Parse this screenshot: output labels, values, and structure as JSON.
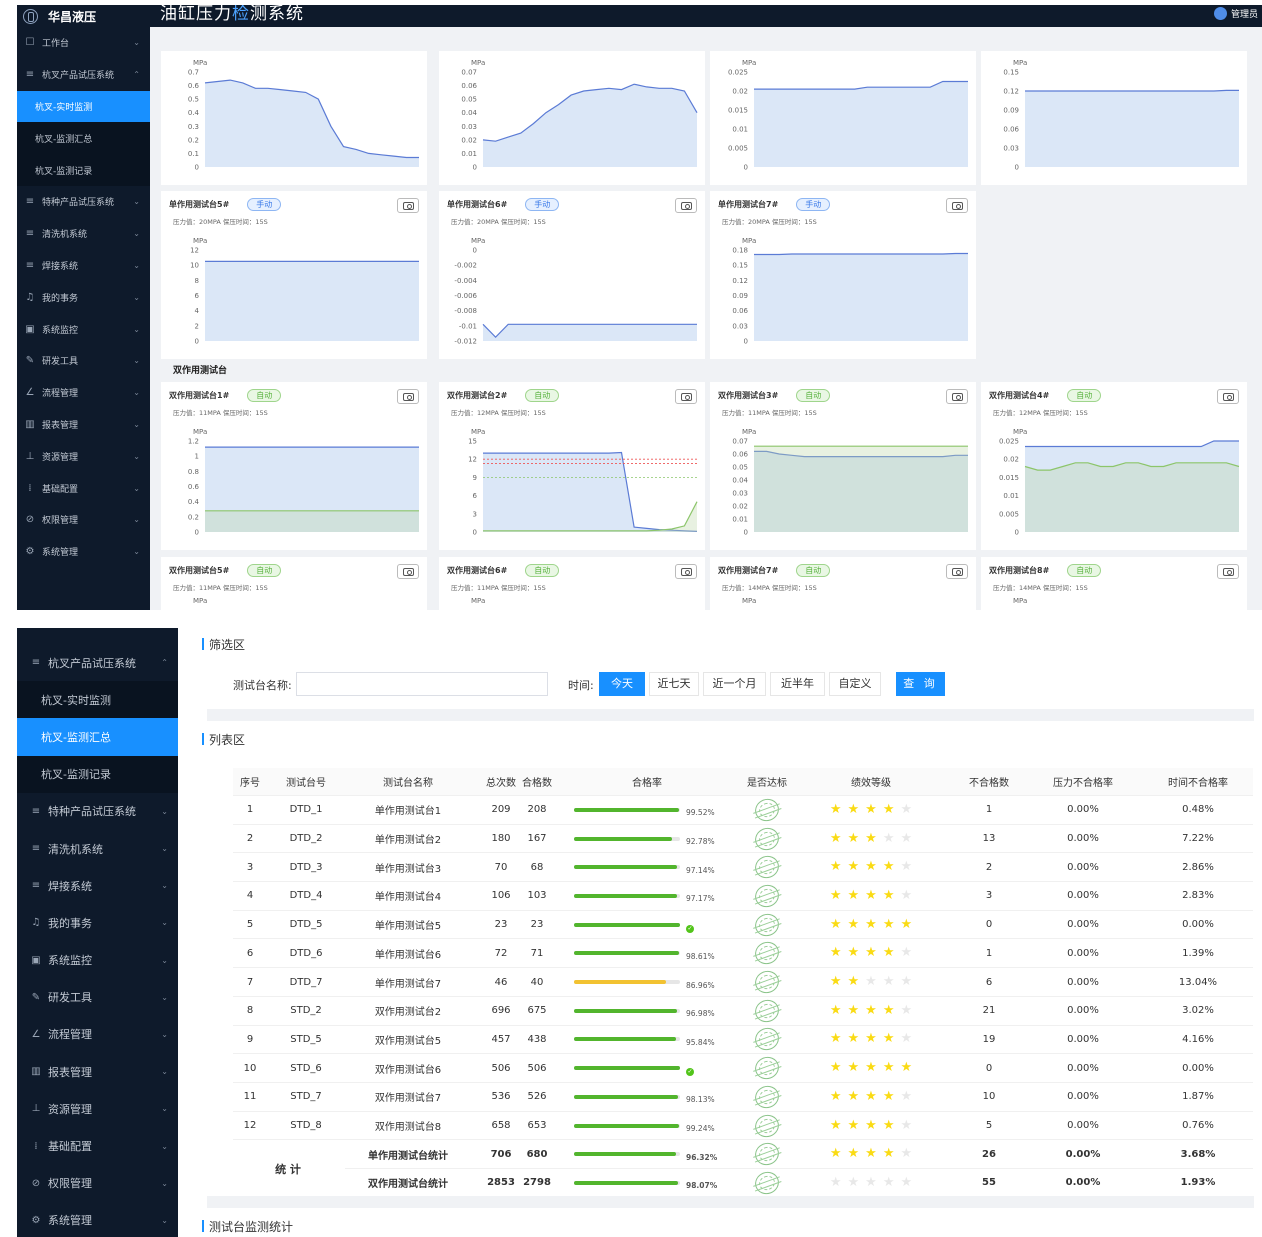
{
  "app": {
    "logo": "华昌液压",
    "title_part1": "油缸压力",
    "title_part2": "检",
    "title_part3": "测系统",
    "user": "管理员"
  },
  "sidebar1": [
    {
      "icon": "☐",
      "label": "工作台",
      "type": "top"
    },
    {
      "icon": "≡",
      "label": "杭叉产品试压系统",
      "type": "top",
      "open": true
    },
    {
      "label": "杭叉-实时监测",
      "type": "sub",
      "active": true
    },
    {
      "label": "杭叉-监测汇总",
      "type": "sub"
    },
    {
      "label": "杭叉-监测记录",
      "type": "sub"
    },
    {
      "icon": "≡",
      "label": "特种产品试压系统",
      "type": "top"
    },
    {
      "icon": "≡",
      "label": "清洗机系统",
      "type": "top"
    },
    {
      "icon": "≡",
      "label": "焊接系统",
      "type": "top"
    },
    {
      "icon": "♫",
      "label": "我的事务",
      "type": "top"
    },
    {
      "icon": "▣",
      "label": "系统监控",
      "type": "top"
    },
    {
      "icon": "✎",
      "label": "研发工具",
      "type": "top"
    },
    {
      "icon": "∠",
      "label": "流程管理",
      "type": "top"
    },
    {
      "icon": "▥",
      "label": "报表管理",
      "type": "top"
    },
    {
      "icon": "⊥",
      "label": "资源管理",
      "type": "top"
    },
    {
      "icon": "⁞",
      "label": "基础配置",
      "type": "top"
    },
    {
      "icon": "⊘",
      "label": "权限管理",
      "type": "top"
    },
    {
      "icon": "⚙",
      "label": "系统管理",
      "type": "top"
    }
  ],
  "sidebar2": [
    {
      "icon": "≡",
      "label": "杭叉产品试压系统",
      "type": "top",
      "open": true
    },
    {
      "label": "杭叉-实时监测",
      "type": "sub"
    },
    {
      "label": "杭叉-监测汇总",
      "type": "sub",
      "active": true
    },
    {
      "label": "杭叉-监测记录",
      "type": "sub"
    },
    {
      "icon": "≡",
      "label": "特种产品试压系统",
      "type": "top"
    },
    {
      "icon": "≡",
      "label": "清洗机系统",
      "type": "top"
    },
    {
      "icon": "≡",
      "label": "焊接系统",
      "type": "top"
    },
    {
      "icon": "♫",
      "label": "我的事务",
      "type": "top"
    },
    {
      "icon": "▣",
      "label": "系统监控",
      "type": "top"
    },
    {
      "icon": "✎",
      "label": "研发工具",
      "type": "top"
    },
    {
      "icon": "∠",
      "label": "流程管理",
      "type": "top"
    },
    {
      "icon": "▥",
      "label": "报表管理",
      "type": "top"
    },
    {
      "icon": "⊥",
      "label": "资源管理",
      "type": "top"
    },
    {
      "icon": "⁞",
      "label": "基础配置",
      "type": "top"
    },
    {
      "icon": "⊘",
      "label": "权限管理",
      "type": "top"
    },
    {
      "icon": "⚙",
      "label": "系统管理",
      "type": "top"
    }
  ],
  "section_double": "双作用测试台",
  "chart_data": [
    {
      "type": "area",
      "unit": "MPa",
      "yticks": [
        "0.7",
        "0.6",
        "0.5",
        "0.4",
        "0.3",
        "0.2",
        "0.1",
        "0"
      ],
      "ylim": [
        0,
        0.7
      ],
      "series": [
        {
          "color": "#5b7bd5",
          "y": [
            0.62,
            0.63,
            0.64,
            0.62,
            0.58,
            0.58,
            0.57,
            0.56,
            0.55,
            0.5,
            0.3,
            0.15,
            0.13,
            0.1,
            0.09,
            0.08,
            0.07,
            0.07
          ]
        }
      ]
    },
    {
      "type": "area",
      "unit": "MPa",
      "yticks": [
        "0.07",
        "0.06",
        "0.05",
        "0.04",
        "0.03",
        "0.02",
        "0.01",
        "0"
      ],
      "ylim": [
        0,
        0.07
      ],
      "series": [
        {
          "color": "#5b7bd5",
          "y": [
            0.02,
            0.019,
            0.022,
            0.025,
            0.032,
            0.04,
            0.046,
            0.053,
            0.056,
            0.057,
            0.058,
            0.057,
            0.061,
            0.059,
            0.058,
            0.058,
            0.056,
            0.04
          ]
        }
      ]
    },
    {
      "type": "area",
      "unit": "MPa",
      "yticks": [
        "0.025",
        "0.02",
        "0.015",
        "0.01",
        "0.005",
        "0"
      ],
      "ylim": [
        0,
        0.025
      ],
      "series": [
        {
          "color": "#5b7bd5",
          "y": [
            0.0205,
            0.0205,
            0.0205,
            0.0205,
            0.0205,
            0.0205,
            0.0205,
            0.0205,
            0.0205,
            0.021,
            0.021,
            0.021,
            0.021,
            0.021,
            0.021,
            0.0225,
            0.0225,
            0.0225
          ]
        }
      ]
    },
    {
      "type": "area",
      "unit": "MPa",
      "yticks": [
        "0.15",
        "0.12",
        "0.09",
        "0.06",
        "0.03",
        "0"
      ],
      "ylim": [
        0,
        0.15
      ],
      "series": [
        {
          "color": "#5b7bd5",
          "y": [
            0.12,
            0.12,
            0.12,
            0.12,
            0.12,
            0.12,
            0.12,
            0.12,
            0.12,
            0.12,
            0.12,
            0.12,
            0.12,
            0.12,
            0.12,
            0.12,
            0.121,
            0.121
          ]
        }
      ]
    },
    {
      "type": "area",
      "title": "单作用测试台5#",
      "mode": "手动",
      "info": "压力值：20MPA  保压时间：15S",
      "unit": "MPa",
      "yticks": [
        "12",
        "10",
        "8",
        "6",
        "4",
        "2",
        "0"
      ],
      "ylim": [
        0,
        12
      ],
      "series": [
        {
          "color": "#5b7bd5",
          "y": [
            10.5,
            10.5,
            10.5,
            10.5,
            10.5,
            10.5,
            10.5,
            10.5,
            10.5,
            10.5,
            10.5,
            10.5,
            10.5,
            10.5,
            10.5,
            10.5,
            10.5,
            10.5
          ]
        }
      ]
    },
    {
      "type": "area",
      "title": "单作用测试台6#",
      "mode": "手动",
      "info": "压力值：20MPA  保压时间：15S",
      "unit": "MPa",
      "yticks": [
        "0",
        "-0.002",
        "-0.004",
        "-0.006",
        "-0.008",
        "-0.01",
        "-0.012"
      ],
      "ylim": [
        -0.012,
        0
      ],
      "series": [
        {
          "color": "#5b7bd5",
          "y": [
            -0.0098,
            -0.0115,
            -0.0098,
            -0.0098,
            -0.0098,
            -0.0098,
            -0.0098,
            -0.0098,
            -0.0098,
            -0.0098,
            -0.0098,
            -0.0098,
            -0.0098,
            -0.0098,
            -0.0098,
            -0.0098,
            -0.0098,
            -0.0098
          ]
        }
      ]
    },
    {
      "type": "area",
      "title": "单作用测试台7#",
      "mode": "手动",
      "info": "压力值：20MPA  保压时间：15S",
      "unit": "MPa",
      "yticks": [
        "0.18",
        "0.15",
        "0.12",
        "0.09",
        "0.06",
        "0.03",
        "0"
      ],
      "ylim": [
        0,
        0.18
      ],
      "series": [
        {
          "color": "#5b7bd5",
          "y": [
            0.171,
            0.171,
            0.171,
            0.172,
            0.172,
            0.172,
            0.172,
            0.172,
            0.172,
            0.172,
            0.172,
            0.172,
            0.172,
            0.172,
            0.172,
            0.172,
            0.173,
            0.173
          ]
        }
      ]
    },
    {
      "type": "area",
      "title": "双作用测试台1#",
      "mode": "自动",
      "info": "压力值：11MPA  保压时间：15S",
      "unit": "MPa",
      "yticks": [
        "1.2",
        "1",
        "0.8",
        "0.6",
        "0.4",
        "0.2",
        "0"
      ],
      "ylim": [
        0,
        1.2
      ],
      "series": [
        {
          "color": "#5b7bd5",
          "y": [
            1.12,
            1.12,
            1.12,
            1.12,
            1.12,
            1.12,
            1.12,
            1.12,
            1.12,
            1.12,
            1.12,
            1.12,
            1.12,
            1.12,
            1.12,
            1.12,
            1.12,
            1.12
          ]
        },
        {
          "color": "#8cc56a",
          "y": [
            0.28,
            0.28,
            0.28,
            0.28,
            0.28,
            0.28,
            0.28,
            0.28,
            0.28,
            0.28,
            0.28,
            0.28,
            0.28,
            0.28,
            0.28,
            0.28,
            0.28,
            0.28
          ]
        }
      ]
    },
    {
      "type": "area",
      "title": "双作用测试台2#",
      "mode": "自动",
      "info": "压力值：12MPA  保压时间：15S",
      "unit": "MPa",
      "yticks": [
        "15",
        "12",
        "9",
        "6",
        "3",
        "0"
      ],
      "ylim": [
        0,
        15
      ],
      "refs": [
        {
          "y": 12,
          "color": "#e55"
        },
        {
          "y": 11.3,
          "color": "#e55"
        },
        {
          "y": 9,
          "color": "#8cc56a"
        }
      ],
      "series": [
        {
          "color": "#5b7bd5",
          "y": [
            13,
            13,
            13,
            13,
            13,
            13,
            13,
            13,
            13,
            13,
            13,
            13.1,
            0.8,
            0.6,
            0.4,
            0.3,
            0.2,
            0.1
          ]
        },
        {
          "color": "#8cc56a",
          "y": [
            0.2,
            0.2,
            0.2,
            0.2,
            0.2,
            0.2,
            0.2,
            0.2,
            0.2,
            0.2,
            0.2,
            0.2,
            0.2,
            0.2,
            0.3,
            0.5,
            1,
            5
          ]
        }
      ]
    },
    {
      "type": "area",
      "title": "双作用测试台3#",
      "mode": "自动",
      "info": "压力值：11MPA  保压时间：15S",
      "unit": "MPa",
      "yticks": [
        "0.07",
        "0.06",
        "0.05",
        "0.04",
        "0.03",
        "0.02",
        "0.01",
        "0"
      ],
      "ylim": [
        0,
        0.07
      ],
      "series": [
        {
          "color": "#5b7bd5",
          "y": [
            0.062,
            0.062,
            0.06,
            0.059,
            0.058,
            0.058,
            0.058,
            0.058,
            0.058,
            0.058,
            0.058,
            0.058,
            0.058,
            0.058,
            0.058,
            0.058,
            0.059,
            0.059
          ]
        },
        {
          "color": "#8cc56a",
          "y": [
            0.066,
            0.066,
            0.066,
            0.066,
            0.066,
            0.066,
            0.066,
            0.066,
            0.066,
            0.066,
            0.066,
            0.066,
            0.066,
            0.066,
            0.066,
            0.066,
            0.066,
            0.066
          ]
        }
      ]
    },
    {
      "type": "area",
      "title": "双作用测试台4#",
      "mode": "自动",
      "info": "压力值：12MPA  保压时间：15S",
      "unit": "MPa",
      "yticks": [
        "0.025",
        "0.02",
        "0.015",
        "0.01",
        "0.005",
        "0"
      ],
      "ylim": [
        0,
        0.025
      ],
      "series": [
        {
          "color": "#5b7bd5",
          "y": [
            0.0235,
            0.0235,
            0.0235,
            0.0235,
            0.0235,
            0.0235,
            0.0235,
            0.0235,
            0.0235,
            0.0235,
            0.0235,
            0.0235,
            0.0235,
            0.0235,
            0.0235,
            0.025,
            0.025,
            0.025
          ]
        },
        {
          "color": "#8cc56a",
          "y": [
            0.018,
            0.017,
            0.017,
            0.018,
            0.019,
            0.019,
            0.018,
            0.018,
            0.019,
            0.019,
            0.018,
            0.018,
            0.019,
            0.019,
            0.019,
            0.019,
            0.019,
            0.018
          ]
        }
      ]
    }
  ],
  "bottom_cards": [
    {
      "title": "双作用测试台5#",
      "mode": "自动",
      "info": "压力值：11MPA  保压时间：15S",
      "unit": "MPa"
    },
    {
      "title": "双作用测试台6#",
      "mode": "自动",
      "info": "压力值：11MPA  保压时间：15S",
      "unit": "MPa"
    },
    {
      "title": "双作用测试台7#",
      "mode": "自动",
      "info": "压力值：14MPA  保压时间：15S",
      "unit": "MPa"
    },
    {
      "title": "双作用测试台8#",
      "mode": "自动",
      "info": "压力值：14MPA  保压时间：15S",
      "unit": "MPa"
    }
  ],
  "filter": {
    "section": "筛选区",
    "name_label": "测试台名称:",
    "time_label": "时间:",
    "ranges": [
      "今天",
      "近七天",
      "近一个月",
      "近半年",
      "自定义"
    ],
    "query": "查 询"
  },
  "list": {
    "section": "列表区",
    "headers": [
      "序号",
      "测试台号",
      "测试台名称",
      "总次数",
      "合格数",
      "合格率",
      "是否达标",
      "绩效等级",
      "不合格数",
      "压力不合格率",
      "时间不合格率"
    ],
    "rows": [
      {
        "no": "1",
        "id": "DTD_1",
        "name": "单作用测试台1",
        "total": "209",
        "pass": "208",
        "rate": "99.52%",
        "rate_value": 99.52,
        "stars": 4,
        "fail": "1",
        "pfail": "0.00%",
        "tfail": "0.48%"
      },
      {
        "no": "2",
        "id": "DTD_2",
        "name": "单作用测试台2",
        "total": "180",
        "pass": "167",
        "rate": "92.78%",
        "rate_value": 92.78,
        "stars": 3,
        "fail": "13",
        "pfail": "0.00%",
        "tfail": "7.22%"
      },
      {
        "no": "3",
        "id": "DTD_3",
        "name": "单作用测试台3",
        "total": "70",
        "pass": "68",
        "rate": "97.14%",
        "rate_value": 97.14,
        "stars": 4,
        "fail": "2",
        "pfail": "0.00%",
        "tfail": "2.86%"
      },
      {
        "no": "4",
        "id": "DTD_4",
        "name": "单作用测试台4",
        "total": "106",
        "pass": "103",
        "rate": "97.17%",
        "rate_value": 97.17,
        "stars": 4,
        "fail": "3",
        "pfail": "0.00%",
        "tfail": "2.83%"
      },
      {
        "no": "5",
        "id": "DTD_5",
        "name": "单作用测试台5",
        "total": "23",
        "pass": "23",
        "rate": "",
        "rate_value": 100,
        "stars": 5,
        "fail": "0",
        "pfail": "0.00%",
        "tfail": "0.00%"
      },
      {
        "no": "6",
        "id": "DTD_6",
        "name": "单作用测试台6",
        "total": "72",
        "pass": "71",
        "rate": "98.61%",
        "rate_value": 98.61,
        "stars": 4,
        "fail": "1",
        "pfail": "0.00%",
        "tfail": "1.39%"
      },
      {
        "no": "7",
        "id": "DTD_7",
        "name": "单作用测试台7",
        "total": "46",
        "pass": "40",
        "rate": "86.96%",
        "rate_value": 86.96,
        "stars": 2,
        "fail": "6",
        "pfail": "0.00%",
        "tfail": "13.04%",
        "bar_color": "#f2c231"
      },
      {
        "no": "8",
        "id": "STD_2",
        "name": "双作用测试台2",
        "total": "696",
        "pass": "675",
        "rate": "96.98%",
        "rate_value": 96.98,
        "stars": 4,
        "fail": "21",
        "pfail": "0.00%",
        "tfail": "3.02%"
      },
      {
        "no": "9",
        "id": "STD_5",
        "name": "双作用测试台5",
        "total": "457",
        "pass": "438",
        "rate": "95.84%",
        "rate_value": 95.84,
        "stars": 4,
        "fail": "19",
        "pfail": "0.00%",
        "tfail": "4.16%"
      },
      {
        "no": "10",
        "id": "STD_6",
        "name": "双作用测试台6",
        "total": "506",
        "pass": "506",
        "rate": "",
        "rate_value": 100,
        "stars": 5,
        "fail": "0",
        "pfail": "0.00%",
        "tfail": "0.00%"
      },
      {
        "no": "11",
        "id": "STD_7",
        "name": "双作用测试台7",
        "total": "536",
        "pass": "526",
        "rate": "98.13%",
        "rate_value": 98.13,
        "stars": 4,
        "fail": "10",
        "pfail": "0.00%",
        "tfail": "1.87%"
      },
      {
        "no": "12",
        "id": "STD_8",
        "name": "双作用测试台8",
        "total": "658",
        "pass": "653",
        "rate": "99.24%",
        "rate_value": 99.24,
        "stars": 4,
        "fail": "5",
        "pfail": "0.00%",
        "tfail": "0.76%"
      }
    ],
    "summary_label": "统 计",
    "summary": [
      {
        "name": "单作用测试台统计",
        "total": "706",
        "pass": "680",
        "rate": "96.32%",
        "rate_value": 96.32,
        "stars": 4,
        "fail": "26",
        "pfail": "0.00%",
        "tfail": "3.68%"
      },
      {
        "name": "双作用测试台统计",
        "total": "2853",
        "pass": "2798",
        "rate": "98.07%",
        "rate_value": 98.07,
        "stars": 0,
        "fail": "55",
        "pfail": "0.00%",
        "tfail": "1.93%"
      }
    ]
  },
  "stats_section": "测试台监测统计"
}
